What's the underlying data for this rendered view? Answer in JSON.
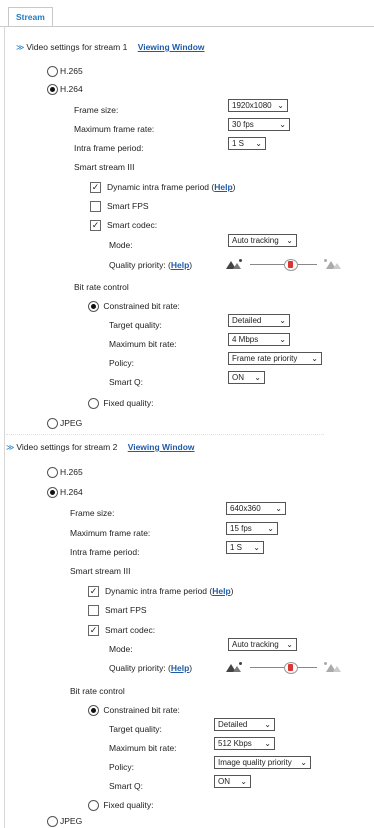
{
  "tab": {
    "label": "Stream"
  },
  "streams": [
    {
      "header": "Video settings for stream 1",
      "viewing_window": "Viewing Window",
      "codecs": {
        "h265": "H.265",
        "h264": "H.264",
        "jpeg": "JPEG",
        "selected": "H.264"
      },
      "frame_size": {
        "label": "Frame size:",
        "value": "1920x1080"
      },
      "max_frame_rate": {
        "label": "Maximum frame rate:",
        "value": "30 fps"
      },
      "intra_frame_period": {
        "label": "Intra frame period:",
        "value": "1 S"
      },
      "smart_stream": {
        "label": "Smart stream III"
      },
      "dynamic_intra": {
        "label": "Dynamic intra frame period (",
        "help": "Help",
        "close": ")",
        "checked": true
      },
      "smart_fps": {
        "label": "Smart FPS",
        "checked": false
      },
      "smart_codec": {
        "label": "Smart codec:",
        "checked": true
      },
      "mode": {
        "label": "Mode:",
        "value": "Auto tracking"
      },
      "quality_priority": {
        "label": "Quality priority: (",
        "help": "Help",
        "close": ")",
        "slider_fraction": 0.5
      },
      "bit_rate_control": {
        "label": "Bit rate control"
      },
      "constrained": {
        "label": "Constrained bit rate:",
        "selected": true
      },
      "target_quality": {
        "label": "Target quality:",
        "value": "Detailed"
      },
      "max_bit_rate": {
        "label": "Maximum bit rate:",
        "value": "4 Mbps"
      },
      "policy": {
        "label": "Policy:",
        "value": "Frame rate priority"
      },
      "smart_q": {
        "label": "Smart Q:",
        "value": "ON"
      },
      "fixed_quality": {
        "label": "Fixed quality:",
        "selected": false
      }
    },
    {
      "header": "Video settings for stream 2",
      "viewing_window": "Viewing Window",
      "codecs": {
        "h265": "H.265",
        "h264": "H.264",
        "jpeg": "JPEG",
        "selected": "H.264"
      },
      "frame_size": {
        "label": "Frame size:",
        "value": "640x360"
      },
      "max_frame_rate": {
        "label": "Maximum frame rate:",
        "value": "15 fps"
      },
      "intra_frame_period": {
        "label": "Intra frame period:",
        "value": "1 S"
      },
      "smart_stream": {
        "label": "Smart stream III"
      },
      "dynamic_intra": {
        "label": "Dynamic intra frame period (",
        "help": "Help",
        "close": ")",
        "checked": true
      },
      "smart_fps": {
        "label": "Smart FPS",
        "checked": false
      },
      "smart_codec": {
        "label": "Smart codec:",
        "checked": true
      },
      "mode": {
        "label": "Mode:",
        "value": "Auto tracking"
      },
      "quality_priority": {
        "label": "Quality priority: (",
        "help": "Help",
        "close": ")",
        "slider_fraction": 0.5
      },
      "bit_rate_control": {
        "label": "Bit rate control"
      },
      "constrained": {
        "label": "Constrained bit rate:",
        "selected": true
      },
      "target_quality": {
        "label": "Target quality:",
        "value": "Detailed"
      },
      "max_bit_rate": {
        "label": "Maximum bit rate:",
        "value": "512 Kbps"
      },
      "policy": {
        "label": "Policy:",
        "value": "Image quality priority"
      },
      "smart_q": {
        "label": "Smart Q:",
        "value": "ON"
      },
      "fixed_quality": {
        "label": "Fixed quality:",
        "selected": false
      }
    }
  ],
  "icons": {
    "chevron": "chevron-down-icon",
    "dropdown": "dropdown-arrow-icon",
    "checkmark": "checkmark-icon",
    "mountain": "landscape-icon"
  },
  "colors": {
    "accent": "#1f7bc4",
    "link": "#1f5ba8",
    "slider_thumb": "#d33333"
  }
}
